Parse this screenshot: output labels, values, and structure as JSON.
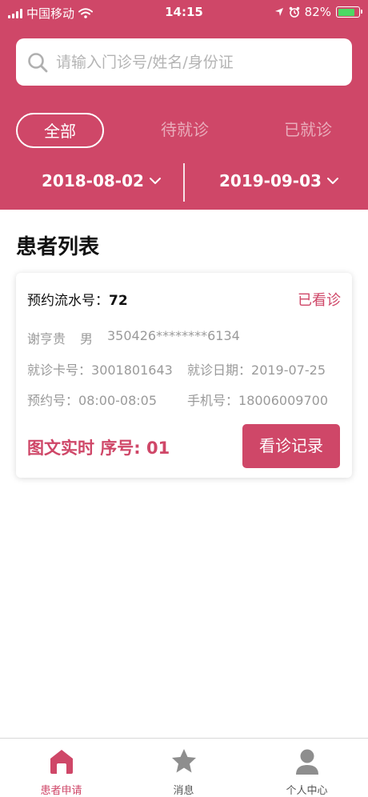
{
  "status_bar": {
    "carrier": "中国移动",
    "time": "14:15",
    "battery": "82%"
  },
  "search": {
    "placeholder": "请输入门诊号/姓名/身份证"
  },
  "tabs": [
    {
      "label": "全部",
      "active": true
    },
    {
      "label": "待就诊",
      "active": false
    },
    {
      "label": "已就诊",
      "active": false
    }
  ],
  "date_range": {
    "start": "2018-08-02",
    "end": "2019-09-03"
  },
  "list_title": "患者列表",
  "patients": [
    {
      "serial_label": "预约流水号：",
      "serial_value": "72",
      "status": "已看诊",
      "name": "谢亨贵",
      "gender": "男",
      "id_number": "350426********6134",
      "card_label": "就诊卡号：",
      "card_value": "3001801643",
      "visit_date_label": "就诊日期：",
      "visit_date_value": "2019-07-25",
      "appointment_label": "预约号：",
      "appointment_value": "08:00-08:05",
      "phone_label": "手机号：",
      "phone_value": "18006009700",
      "consult_info": "图文实时 序号: 01",
      "record_button": "看诊记录"
    }
  ],
  "bottom_nav": [
    {
      "label": "患者申请",
      "icon": "home-icon",
      "active": true
    },
    {
      "label": "消息",
      "icon": "star-icon",
      "active": false
    },
    {
      "label": "个人中心",
      "icon": "person-icon",
      "active": false
    }
  ],
  "colors": {
    "brand": "#cf4768",
    "inactive_icon": "#8e8e8e",
    "battery": "#4cd964"
  }
}
